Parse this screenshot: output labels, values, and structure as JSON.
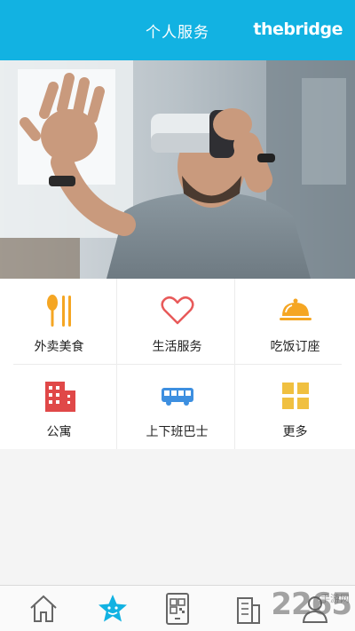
{
  "header": {
    "title": "个人服务",
    "brand": "thebridge"
  },
  "banner": {
    "icon": "vr-headset-photo"
  },
  "services": [
    {
      "label": "外卖美食",
      "icon": "fork-spoon-icon",
      "color": "#f5a623"
    },
    {
      "label": "生活服务",
      "icon": "heart-icon",
      "color": "#e85a5a"
    },
    {
      "label": "吃饭订座",
      "icon": "cloche-icon",
      "color": "#f5a623"
    },
    {
      "label": "公寓",
      "icon": "building-icon",
      "color": "#e04848"
    },
    {
      "label": "上下班巴士",
      "icon": "bus-icon",
      "color": "#3d8fe0"
    },
    {
      "label": "更多",
      "icon": "grid-icon",
      "color": "#f0c040"
    }
  ],
  "tabbar": {
    "tabs": [
      {
        "icon": "home-icon",
        "active": false
      },
      {
        "icon": "star-icon",
        "active": true
      },
      {
        "icon": "qr-scan-icon",
        "active": false
      },
      {
        "icon": "building-icon",
        "active": false
      },
      {
        "icon": "user-icon",
        "active": false
      }
    ],
    "active_color": "#12b2e2"
  },
  "watermark": {
    "text": "2265",
    "suffix": "手游网"
  }
}
